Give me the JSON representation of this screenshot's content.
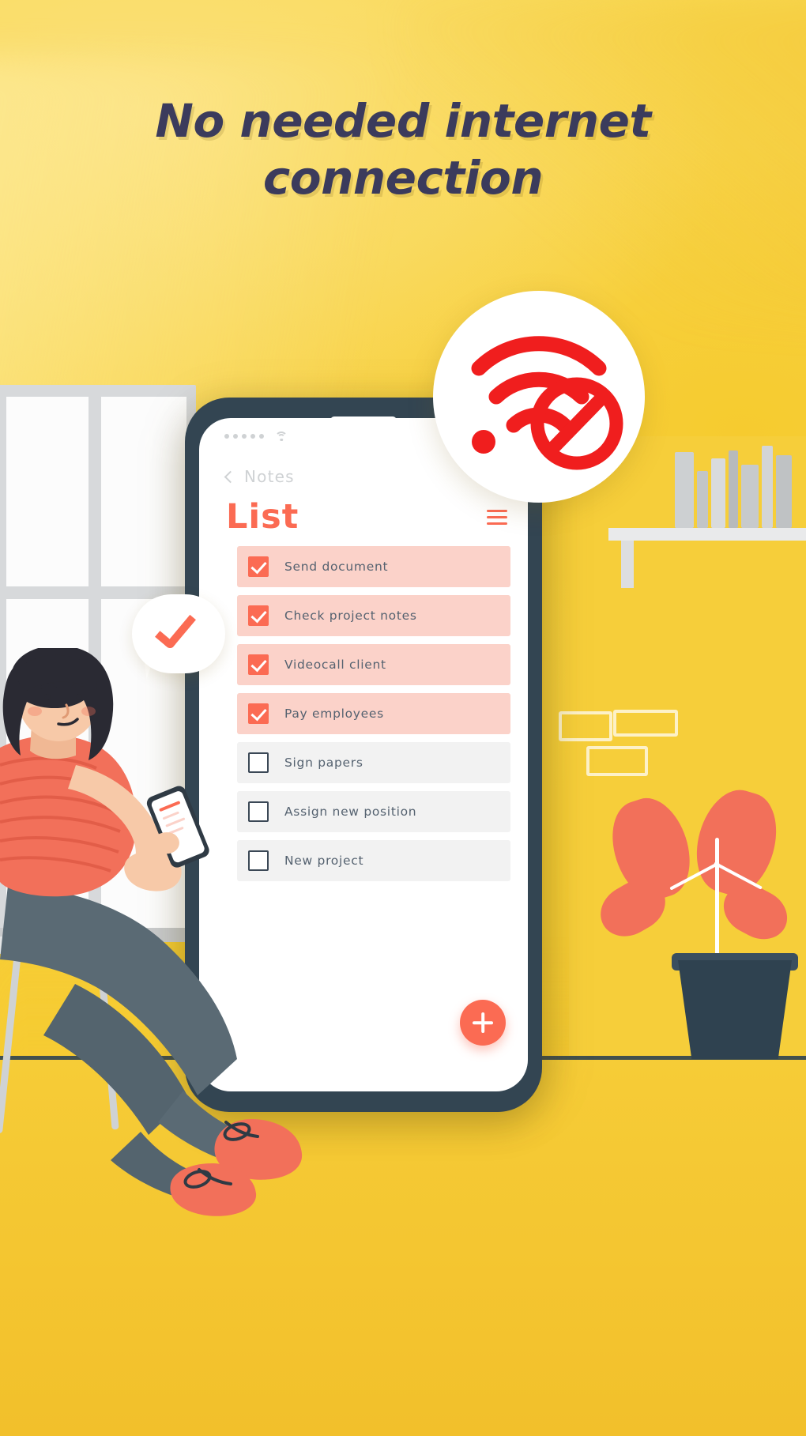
{
  "headline": {
    "line1": "No needed internet",
    "line2": "connection",
    "color": "#3B3B5C"
  },
  "theme": {
    "background_yellow": "#F7D33F",
    "accent_coral": "#FB6B53",
    "badge_red": "#F01E1E",
    "phone_body": "#334552",
    "row_done_bg": "#FBD2C9",
    "row_todo_bg": "#F2F2F2",
    "muted_text": "#CFD2D4"
  },
  "badge": {
    "icon": "no-wifi-icon",
    "description": "wifi signal with prohibition sign",
    "color": "#F01E1E"
  },
  "bubble": {
    "icon": "check-icon",
    "color": "#FB6B53"
  },
  "phone": {
    "statusbar": {
      "dots_count": 5,
      "wifi_icon": "wifi-icon"
    },
    "back_nav": {
      "icon": "chevron-left-icon",
      "label": "Notes"
    },
    "header": {
      "title": "List",
      "menu_icon": "hamburger-menu-icon"
    },
    "fab": {
      "icon": "plus-icon",
      "label": "+"
    },
    "todos": [
      {
        "label": "Send document",
        "checked": true
      },
      {
        "label": "Check project notes",
        "checked": true
      },
      {
        "label": "Videocall client",
        "checked": true
      },
      {
        "label": "Pay employees",
        "checked": true
      },
      {
        "label": "Sign papers",
        "checked": false
      },
      {
        "label": "Assign new position",
        "checked": false
      },
      {
        "label": "New project",
        "checked": false
      }
    ]
  },
  "scene": {
    "window": "window-illustration",
    "shelf": "bookshelf-illustration",
    "plant": "potted-plant-illustration",
    "person": "woman-sitting-with-phone-illustration",
    "chair": "chair-illustration",
    "wall_frames": "wall-picture-frames"
  }
}
